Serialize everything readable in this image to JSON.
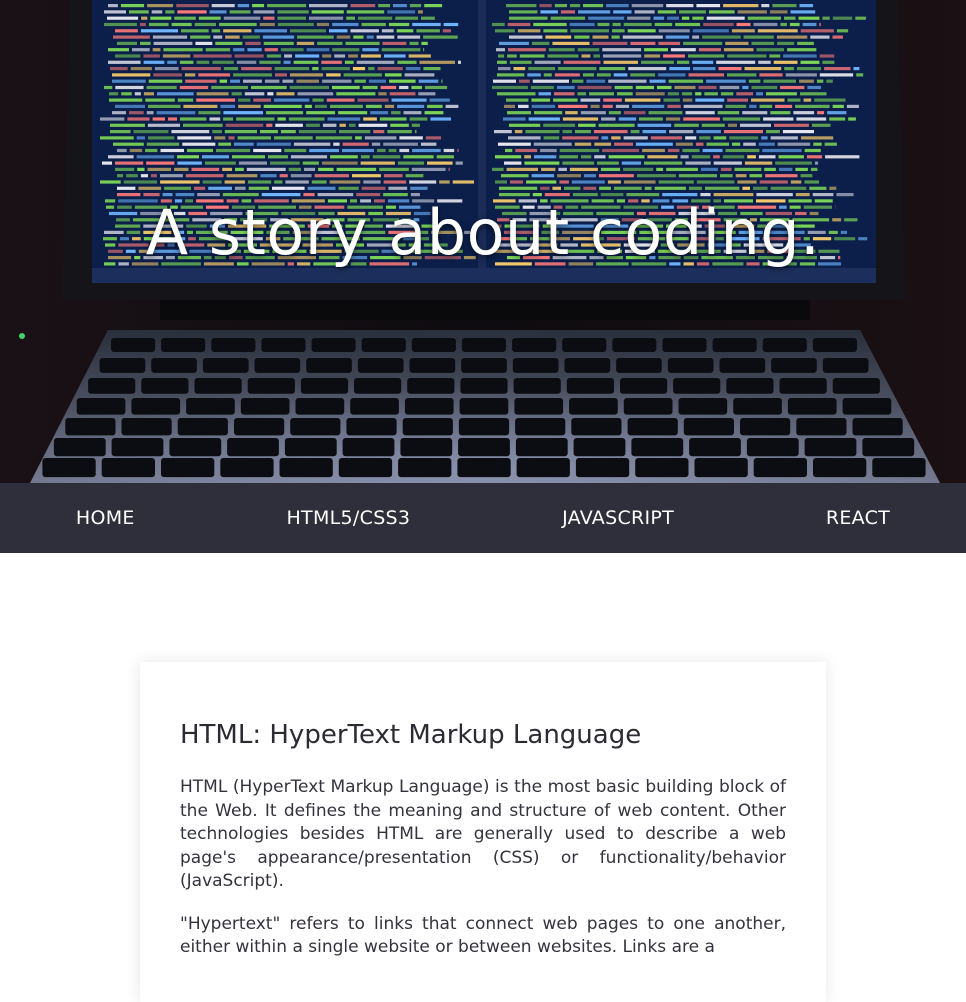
{
  "hero": {
    "title": "A story about coding.",
    "image": "laptop-with-code-photo"
  },
  "nav": {
    "items": [
      {
        "label": "HOME"
      },
      {
        "label": "HTML5/CSS3"
      },
      {
        "label": "JAVASCRIPT"
      },
      {
        "label": "REACT"
      }
    ]
  },
  "article": {
    "heading": "HTML: HyperText Markup Language",
    "paragraphs": [
      "HTML (HyperText Markup Language) is the most basic building block of the Web. It defines the meaning and structure of web content. Other technologies besides HTML are generally used to describe a web page's appearance/presentation (CSS) or functionality/behavior (JavaScript).",
      "\"Hypertext\" refers to links that connect web pages to one another, either within a single website or between websites. Links are a"
    ]
  },
  "colors": {
    "nav_background": "#2e2f3b",
    "text": "#33333d",
    "code_green": "#7ed957",
    "screen_background": "#0b1f4a"
  }
}
